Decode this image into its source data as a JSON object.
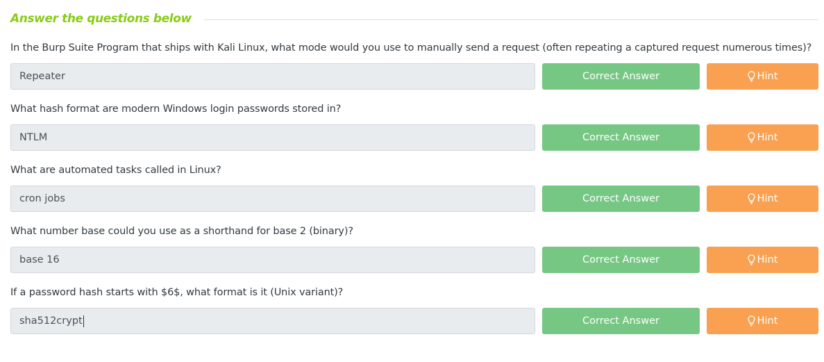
{
  "section": {
    "title": "Answer the questions below"
  },
  "colors": {
    "title_green": "#88cc14",
    "correct_green": "#76c784",
    "hint_orange": "#f9a150",
    "input_bg": "#e9ecef"
  },
  "icons": {
    "hint": "lightbulb-icon"
  },
  "questions": [
    {
      "text": "In the Burp Suite Program that ships with Kali Linux, what mode would you use to manually send a request (often repeating a captured request numerous times)?",
      "answer": "Repeater",
      "status_label": "Correct Answer",
      "hint_label": "Hint"
    },
    {
      "text": "What hash format are modern Windows login passwords stored in?",
      "answer": "NTLM",
      "status_label": "Correct Answer",
      "hint_label": "Hint"
    },
    {
      "text": "What are automated tasks called in Linux?",
      "answer": "cron jobs",
      "status_label": "Correct Answer",
      "hint_label": "Hint"
    },
    {
      "text": "What number base could you use as a shorthand for base 2 (binary)?",
      "answer": "base 16",
      "status_label": "Correct Answer",
      "hint_label": "Hint"
    },
    {
      "text": "If a password hash starts with $6$, what format is it (Unix variant)?",
      "answer": "sha512crypt",
      "status_label": "Correct Answer",
      "hint_label": "Hint"
    }
  ]
}
